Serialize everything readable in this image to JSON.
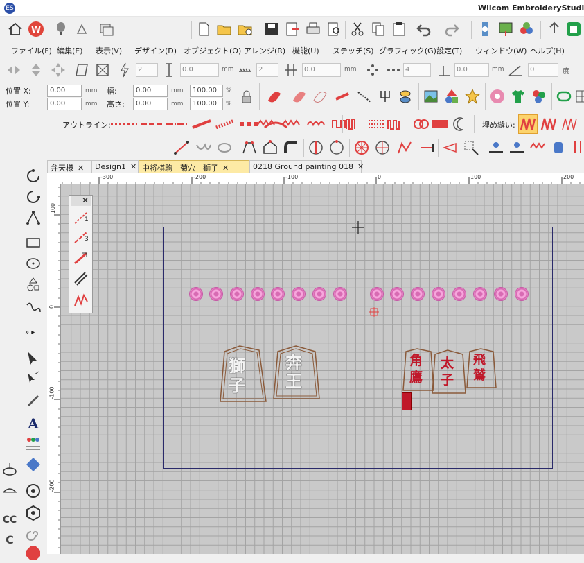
{
  "window": {
    "title": "Wilcom EmbroideryStudio -"
  },
  "menu": {
    "items": [
      "ファイル(F)",
      "編集(E)",
      "表示(V)",
      "デザイン(D)",
      "オブジェクト(O)",
      "アレンジ(R)",
      "機能(U)",
      "ステッチ(S)",
      "グラフィック(G)",
      "設定(T)",
      "ウィンドウ(W)",
      "ヘルプ(H)"
    ]
  },
  "transform_bar": {
    "spin1": "2",
    "field1": "0.0",
    "unit1": "mm",
    "spin2": "2",
    "field2": "0.0",
    "unit2": "mm",
    "spin3": "4",
    "field3": "0.0",
    "unit3": "mm",
    "field4": "0",
    "unit4": "度"
  },
  "props": {
    "pos_x_label": "位置 X:",
    "pos_y_label": "位置 Y:",
    "pos_x": "0.00",
    "pos_y": "0.00",
    "unit": "mm",
    "width_label": "幅:",
    "height_label": "高さ:",
    "width": "0.00",
    "height": "0.00",
    "scale_w": "100.00",
    "scale_h": "100.00",
    "pct": "%"
  },
  "stitch_bar": {
    "outline_label": "アウトライン:",
    "fill_label": "埋め縫い:"
  },
  "tabs": [
    {
      "label": "弁天様",
      "active": false
    },
    {
      "label": "Design1",
      "active": false
    },
    {
      "label": "中将棋駒　菊穴　獅子",
      "active": true
    },
    {
      "label": "0218 Ground painting 018",
      "active": false
    }
  ],
  "ruler": {
    "h_labels": [
      "-300",
      "-200",
      "-100",
      "0",
      "100",
      "200"
    ],
    "v_labels": [
      "100",
      "0",
      "-100",
      "-200"
    ]
  },
  "popup_labels": {
    "one": "1",
    "three": "3"
  },
  "design": {
    "pieces": [
      {
        "top": "獅",
        "bottom": "子",
        "color": "#f4f4f4"
      },
      {
        "top": "奔",
        "bottom": "王",
        "color": "#f4f4f4"
      },
      {
        "top": "角",
        "bottom": "鷹",
        "color": "#c0182a"
      },
      {
        "top": "太",
        "bottom": "子",
        "color": "#c0182a"
      },
      {
        "top": "飛",
        "bottom": "鷲",
        "color": "#c0182a"
      }
    ]
  },
  "colors": {
    "accent": "#e04040",
    "brand": "#2b4fa8",
    "outline_brown": "#8a5a3a",
    "seal_red": "#c0182a",
    "circle_pink": "#f6a6dc"
  },
  "icons": {
    "home": "home-icon",
    "wilcom": "wilcom-logo-icon",
    "balloon": "balloon-icon",
    "new": "new-file-icon",
    "open": "open-folder-icon",
    "save": "save-icon",
    "print": "print-icon",
    "cut": "scissors-icon",
    "copy": "copy-icon",
    "paste": "paste-icon",
    "undo": "undo-icon",
    "redo": "redo-icon"
  }
}
